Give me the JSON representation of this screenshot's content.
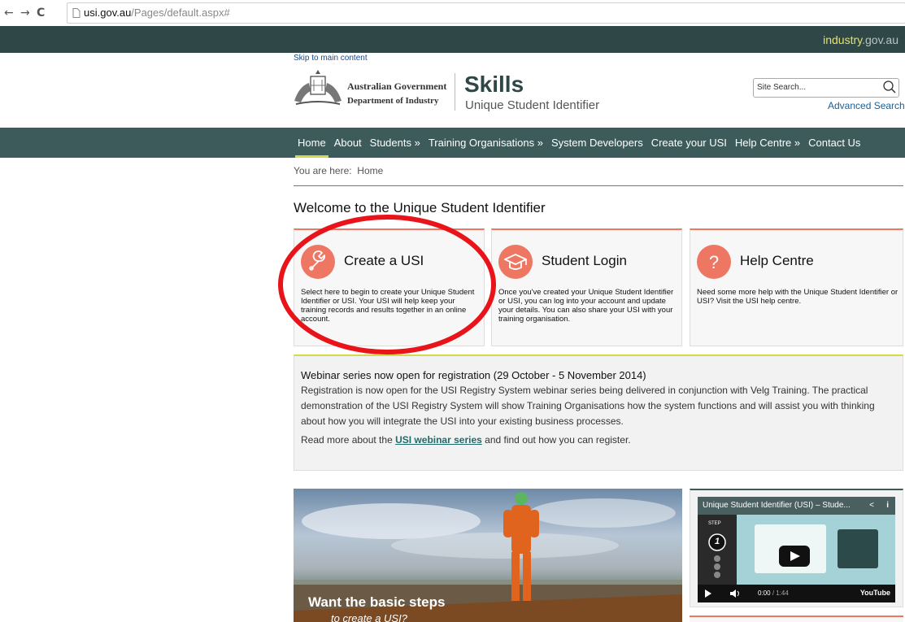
{
  "browser": {
    "url_domain": "usi.gov.au",
    "url_path": "/Pages/default.aspx#"
  },
  "topbar": {
    "industry_name": "industry",
    "industry_tld": ".gov.au"
  },
  "header": {
    "skip_link": "Skip to main content",
    "gov_line1": "Australian Government",
    "gov_line2": "Department of Industry",
    "site_title": "Skills",
    "site_subtitle": "Unique Student Identifier",
    "search_placeholder": "Site Search...",
    "advanced_search": "Advanced Search"
  },
  "nav": {
    "items": [
      {
        "label": "Home"
      },
      {
        "label": "About"
      },
      {
        "label": "Students »"
      },
      {
        "label": "Training Organisations »"
      },
      {
        "label": "System Developers"
      },
      {
        "label": "Create your USI"
      },
      {
        "label": "Help Centre »"
      },
      {
        "label": "Contact Us"
      }
    ]
  },
  "breadcrumb": {
    "prefix": "You are here:",
    "current": "Home"
  },
  "page": {
    "welcome_heading": "Welcome to the Unique Student Identifier"
  },
  "cards": [
    {
      "title": "Create a USI",
      "text": "Select here to begin to create your Unique Student Identifier or USI. Your USI will help keep your training records and results together in an online account.",
      "icon": "wrench-icon"
    },
    {
      "title": "Student Login",
      "text": "Once you've created your Unique Student Identifier or USI, you can log into your account and update your details. You can also share your USI with your training organisation.",
      "icon": "graduation-cap-icon"
    },
    {
      "title": "Help Centre",
      "text": "Need some more help with the Unique Student Identifier or USI? Visit the USI help centre.",
      "icon": "question-icon"
    }
  ],
  "webinar": {
    "title": "Webinar series now open for registration (29 October - 5 November 2014)",
    "body": "Registration is now open for the USI Registry System webinar series being delivered in conjunction with Velg Training. The practical demonstration of the USI Registry System will show Training Organisations how the system functions and will assist you with thinking about how you will integrate the USI into your existing business processes.",
    "more_prefix": "Read more about the",
    "more_link": "USI webinar series",
    "more_suffix": "and find out how you can register."
  },
  "hero": {
    "line1": "Want the basic steps",
    "line2": "to create a USI?"
  },
  "video": {
    "title": "Unique Student Identifier (USI) – Stude...",
    "step_label": "STEP",
    "step_number": "1",
    "time_current": "0:00",
    "time_total": "/ 1:44",
    "brand": "YouTube"
  },
  "colors": {
    "topbar": "#2f4747",
    "nav": "#3d5b5b",
    "accent_coral": "#ee7763",
    "accent_lime": "#d4d94a",
    "annotation_red": "#e8141a"
  }
}
